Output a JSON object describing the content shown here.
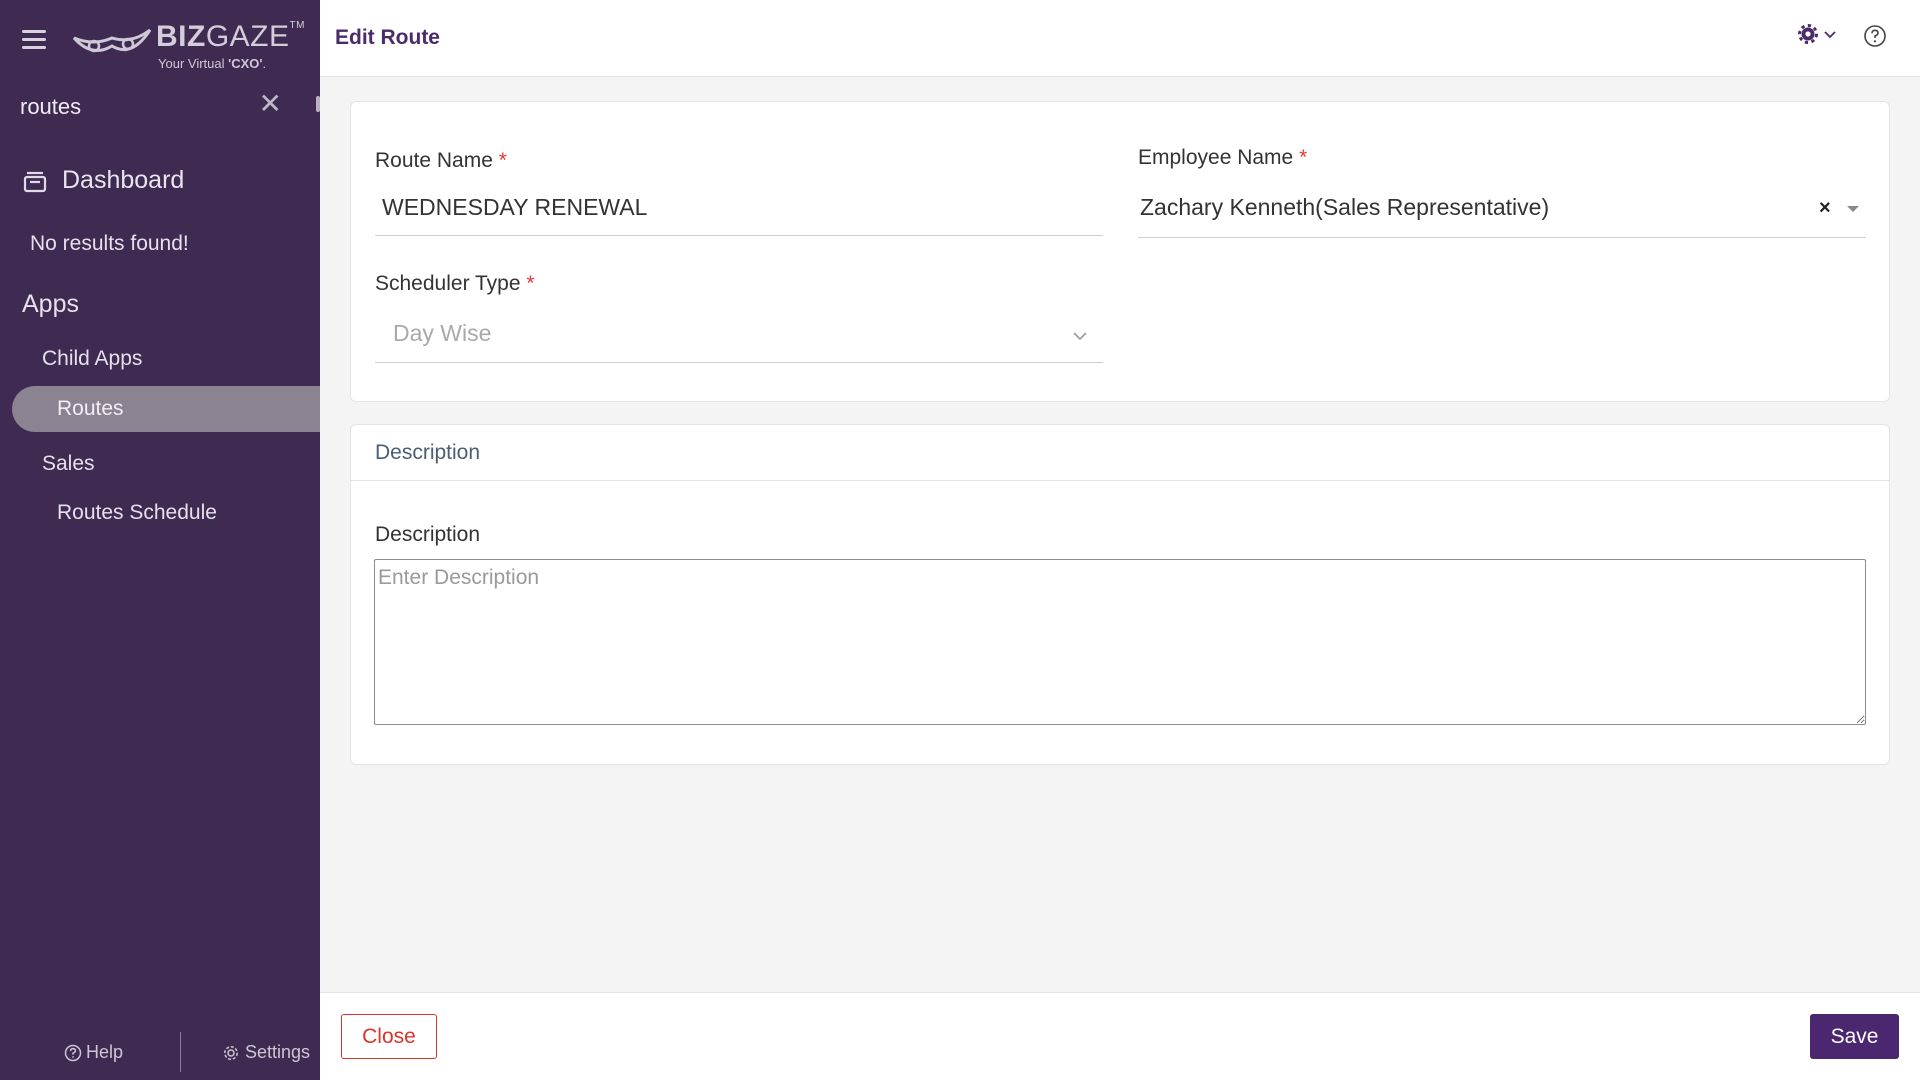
{
  "sidebar": {
    "logo": {
      "brand_bold": "BIZ",
      "brand_light": "GAZE",
      "trademark": "TM",
      "tagline_prefix": "Your Virtual ",
      "tagline_bold": "'CXO'",
      "tagline_suffix": "."
    },
    "search": {
      "value": "routes",
      "clear_icon": "close-icon"
    },
    "dashboard_label": "Dashboard",
    "no_results": "No results found!",
    "apps_heading": "Apps",
    "items": [
      {
        "label": "Child Apps"
      },
      {
        "label": "Routes",
        "active": true
      },
      {
        "label": "Sales"
      },
      {
        "label": "Routes Schedule"
      }
    ],
    "footer": {
      "help_label": "Help",
      "settings_label": "Settings"
    }
  },
  "header": {
    "title": "Edit Route",
    "icons": [
      "gear-icon",
      "chevron-down-icon",
      "help-circle-icon"
    ]
  },
  "form": {
    "route_name": {
      "label": "Route Name",
      "required_mark": "*",
      "value": "WEDNESDAY RENEWAL"
    },
    "employee_name": {
      "label": "Employee Name",
      "required_mark": "*",
      "value": "Zachary Kenneth(Sales Representative)",
      "clear": "×"
    },
    "scheduler_type": {
      "label": "Scheduler Type",
      "required_mark": "*",
      "value": "Day Wise"
    }
  },
  "description_section": {
    "title": "Description",
    "field_label": "Description",
    "placeholder": "Enter Description"
  },
  "actions": {
    "close_label": "Close",
    "save_label": "Save"
  },
  "colors": {
    "sidebar_bg": "#3f2a51",
    "primary": "#4b2770",
    "title": "#4b2c6a",
    "danger": "#d9342b",
    "required": "#e53935"
  }
}
